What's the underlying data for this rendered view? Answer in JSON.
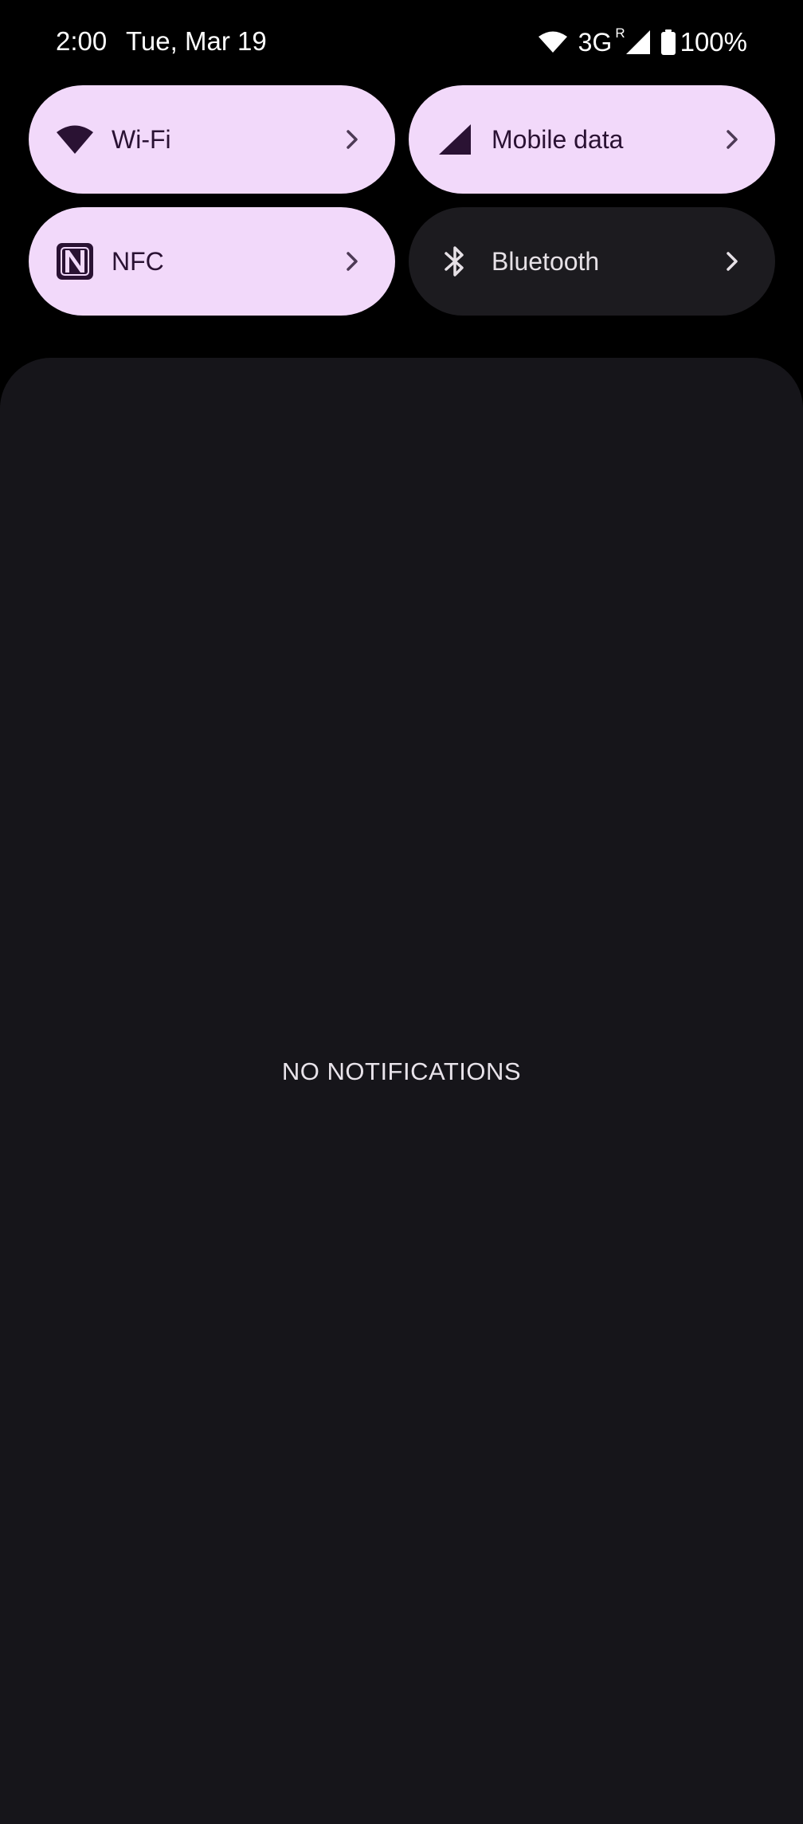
{
  "status_bar": {
    "time": "2:00",
    "date": "Tue, Mar 19",
    "network_type": "3G",
    "roaming_indicator": "R",
    "battery_percent": "100%",
    "icons": [
      "wifi-signal-icon",
      "cell-signal-icon",
      "battery-icon"
    ]
  },
  "quick_settings": {
    "tiles": [
      {
        "label": "Wi-Fi",
        "icon": "wifi-icon",
        "state": "on"
      },
      {
        "label": "Mobile data",
        "icon": "mobile-signal-icon",
        "state": "on"
      },
      {
        "label": "NFC",
        "icon": "nfc-icon",
        "state": "on"
      },
      {
        "label": "Bluetooth",
        "icon": "bluetooth-icon",
        "state": "off"
      }
    ]
  },
  "notifications": {
    "empty_text": "NO NOTIFICATIONS"
  },
  "colors": {
    "tile_on_bg": "#f2d9fa",
    "tile_on_fg": "#2a1233",
    "tile_off_bg": "#1c1b1f",
    "tile_off_fg": "#e6e1e6",
    "shade_bg": "#16151a",
    "background": "#000000"
  }
}
